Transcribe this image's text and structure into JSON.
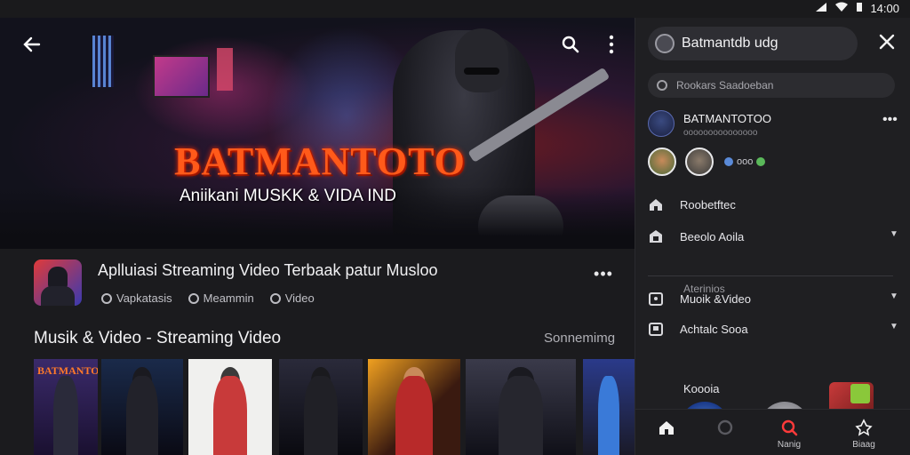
{
  "status_bar": {
    "time": "14:00"
  },
  "hero": {
    "title": "BATMANTOTO",
    "subtitle": "Aniikani MUSKK & VIDA IND",
    "back_icon": "arrow-left-icon",
    "search_icon": "search-icon",
    "more_icon": "more-vertical-icon"
  },
  "app_info": {
    "title": "Aplluiasi Streaming Video Terbaak patur Musloo",
    "tags": [
      "Vapkatasis",
      "Meammin",
      "Video"
    ]
  },
  "section": {
    "title": "Musik & Video - Streaming Video",
    "link": "Sonnemimg"
  },
  "thumbnails": [
    {
      "caption": "BATMANTOO",
      "bg": "#3a2a6a"
    },
    {
      "caption": "",
      "bg": "#1a2a4a"
    },
    {
      "caption": "",
      "bg": "#f0f0ee"
    },
    {
      "caption": "",
      "bg": "#1a1a22"
    },
    {
      "caption": "",
      "bg": "#2a1a10"
    },
    {
      "caption": "",
      "bg": "#1a1a24"
    },
    {
      "caption": "",
      "bg": "#1a1a28"
    }
  ],
  "panel": {
    "search_value": "Batmantdb udg",
    "search2_placeholder": "Rookars Saadoeban",
    "account": {
      "name": "BATMANTOTOO",
      "sub": "ooooooooooooooo"
    },
    "friend_mini_text": "ooo",
    "menu": [
      {
        "label": "Roobetftec",
        "icon": "home-icon",
        "chevron": false
      },
      {
        "label": "Beeolo Aoila",
        "icon": "store-icon",
        "chevron": true
      },
      {
        "label": "Muoik &Video",
        "icon": "calendar-icon",
        "chevron": true
      },
      {
        "label": "Achtalc Sooa",
        "icon": "bookmark-icon",
        "chevron": true
      }
    ],
    "group_label": "Aterinios",
    "recents_label": "Koooia"
  },
  "bottom_nav": [
    {
      "label": "",
      "icon": "home-icon"
    },
    {
      "label": "",
      "icon": "activity-icon"
    },
    {
      "label": "Nanig",
      "icon": "search-icon"
    },
    {
      "label": "Biaag",
      "icon": "profile-icon"
    }
  ],
  "colors": {
    "accent": "#ff5a1a",
    "panel_bg": "#1f1f22",
    "main_bg": "#1b1b1e"
  }
}
